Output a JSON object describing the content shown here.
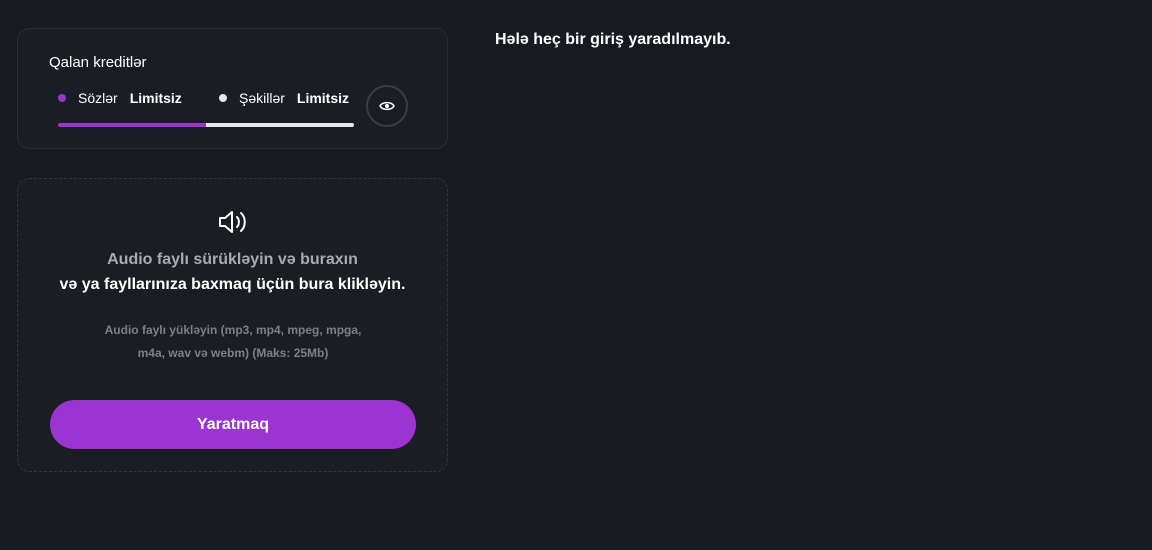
{
  "credits": {
    "title": "Qalan kreditlər",
    "words": {
      "label": "Sözlər",
      "value": "Limitsiz",
      "color": "#9b34d0"
    },
    "images": {
      "label": "Şəkillər",
      "value": "Limitsiz",
      "color": "#e6e6ea"
    },
    "words_share": 0.5,
    "eye_icon": "eye-icon"
  },
  "upload": {
    "icon": "speaker-icon",
    "line1": "Audio faylı sürükləyin və buraxın",
    "line2": "və ya fayllarınıza baxmaq üçün bura klikləyin.",
    "hint_line1": "Audio faylı yükləyin (mp3, mp4, mpeg, mpga,",
    "hint_line2": "m4a, wav və webm) (Maks: 25Mb)",
    "button_label": "Yaratmaq",
    "button_color": "#9b34d0"
  },
  "history": {
    "empty_message": "Hələ heç bir giriş yaradılmayıb."
  }
}
